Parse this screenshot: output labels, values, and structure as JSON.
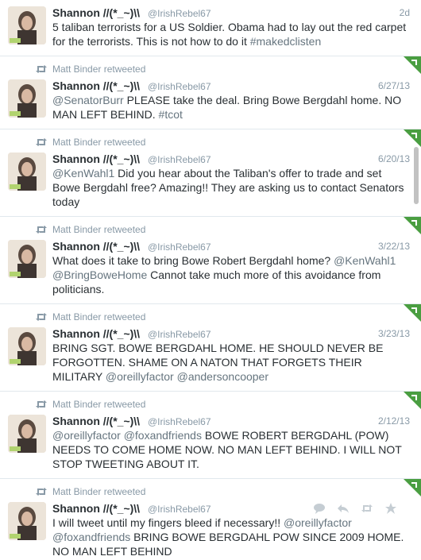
{
  "colors": {
    "link": "#66757f",
    "muted": "#8899a6",
    "text": "#292f33",
    "corner": "#4a9e41"
  },
  "tweets": [
    {
      "retweeted_by": "",
      "name": "Shannon  //(*_~)\\\\",
      "handle": "@IrishRebel67",
      "time": "2d",
      "text_plain": "5 taliban terrorists for a US Soldier. Obama had to lay out the red carpet for the terrorists. This is not how to do it ",
      "hashtag": "#makedclisten"
    },
    {
      "retweeted_by": "Matt Binder retweeted",
      "name": "Shannon  //(*_~)\\\\",
      "handle": "@IrishRebel67",
      "time": "6/27/13",
      "mention": "@SenatorBurr",
      "text_plain": " PLEASE take the deal. Bring Bowe Bergdahl home. NO MAN LEFT BEHIND. ",
      "hashtag": "#tcot"
    },
    {
      "retweeted_by": "Matt Binder retweeted",
      "name": "Shannon  //(*_~)\\\\",
      "handle": "@IrishRebel67",
      "time": "6/20/13",
      "mention": "@KenWahl1",
      "text_plain": " Did you hear about the Taliban's offer to trade and set Bowe Bergdahl free? Amazing!! They are asking us to contact Senators today"
    },
    {
      "retweeted_by": "Matt Binder retweeted",
      "name": "Shannon  //(*_~)\\\\",
      "handle": "@IrishRebel67",
      "time": "3/22/13",
      "text_plain": "What does it take to bring Bowe Robert Bergdahl home? ",
      "mention": "@KenWahl1",
      "mention2": "@BringBoweHome",
      "text_plain2": " Cannot take much more of this avoidance from politicians."
    },
    {
      "retweeted_by": "Matt Binder retweeted",
      "name": "Shannon  //(*_~)\\\\",
      "handle": "@IrishRebel67",
      "time": "3/23/13",
      "text_plain": "BRING SGT. BOWE BERGDAHL HOME. HE SHOULD NEVER BE FORGOTTEN. SHAME ON A NATON THAT FORGETS THEIR MILITARY ",
      "mention": "@oreillyfactor",
      "mention2": "@andersoncooper"
    },
    {
      "retweeted_by": "Matt Binder retweeted",
      "name": "Shannon  //(*_~)\\\\",
      "handle": "@IrishRebel67",
      "time": "2/12/13",
      "mention": "@oreillyfactor",
      "mention2": "@foxandfriends",
      "text_plain": " BOWE ROBERT BERGDAHL (POW) NEEDS TO COME HOME NOW. NO MAN LEFT BEHIND. I WILL NOT STOP TWEETING ABOUT IT."
    },
    {
      "retweeted_by": "Matt Binder retweeted",
      "name": "Shannon  //(*_~)\\\\",
      "handle": "@IrishRebel67",
      "time": "",
      "text_plain": "I will tweet until my fingers bleed if necessary!! ",
      "mention": "@oreillyfactor",
      "mention2": "@foxandfriends",
      "text_plain2": " BRING BOWE BERGDAHL POW SINCE 2009 HOME. NO MAN LEFT BEHIND",
      "actions": [
        "reply-icon",
        "retweet-icon",
        "favorite-icon",
        "conversation-icon"
      ]
    }
  ]
}
